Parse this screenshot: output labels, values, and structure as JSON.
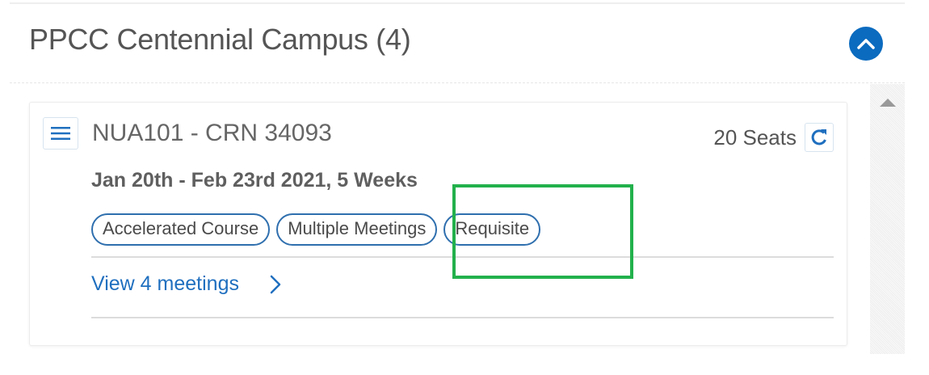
{
  "section": {
    "title": "PPCC Centennial Campus (4)",
    "collapse_icon": "chevron-up-icon"
  },
  "course": {
    "title": "NUA101 - CRN 34093",
    "seats": "20 Seats",
    "dates": "Jan 20th - Feb 23rd 2021, 5 Weeks",
    "tags": [
      "Accelerated Course",
      "Multiple Meetings",
      "Requisite"
    ],
    "view_link": "View 4 meetings"
  },
  "colors": {
    "accent": "#0b6bbf",
    "tag_border": "#2f6fae",
    "link": "#1f6fbf",
    "highlight": "#22b14c"
  }
}
